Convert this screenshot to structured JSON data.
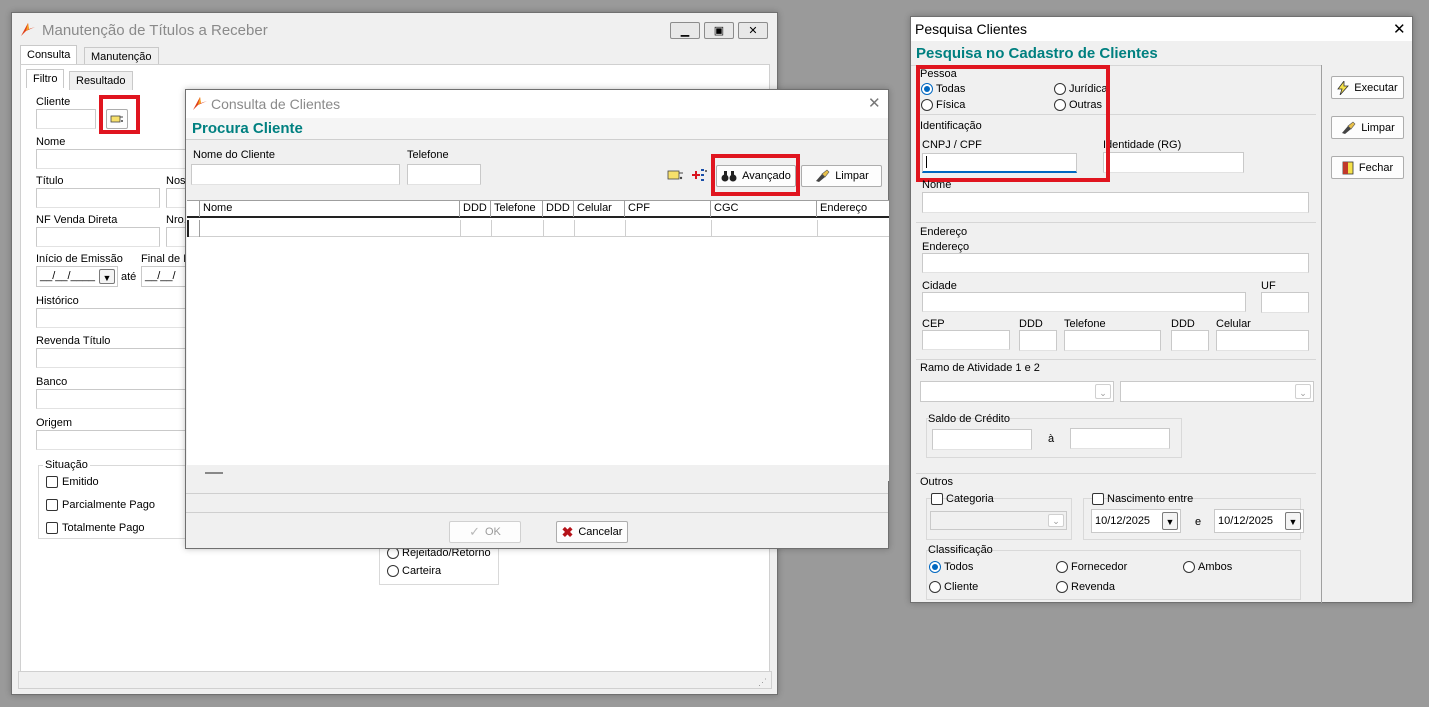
{
  "win1": {
    "title": "Manutenção de Títulos a Receber",
    "tabs": [
      "Consulta",
      "Manutenção"
    ],
    "subtabs": [
      "Filtro",
      "Resultado"
    ],
    "labels": {
      "cliente": "Cliente",
      "nome": "Nome",
      "titulo": "Título",
      "nosso": "Noss",
      "nf_venda": "NF Venda Direta",
      "nro": "Nro.",
      "inicio_emissao": "Início de Emissão",
      "final": "Final de E",
      "ate": "até",
      "historico": "Histórico",
      "revenda": "Revenda Título",
      "banco": "Banco",
      "origem": "Origem"
    },
    "date_value": "__/__/____",
    "date_value2": "__/__/",
    "situacao": {
      "label": "Situação",
      "items": [
        "Emitido",
        "Parcialmente Pago",
        "Totalmente Pago"
      ]
    },
    "extra_radios": [
      "Rejeitado/Retorno",
      "Carteira"
    ]
  },
  "win2": {
    "title": "Consulta de Clientes",
    "heading": "Procura Cliente",
    "labels": {
      "nome_cliente": "Nome do Cliente",
      "telefone": "Telefone"
    },
    "buttons": {
      "avancado": "Avançado",
      "limpar": "Limpar",
      "ok": "OK",
      "cancelar": "Cancelar"
    },
    "grid_columns": [
      "Nome",
      "DDD",
      "Telefone",
      "DDD",
      "Celular",
      "CPF",
      "CGC",
      "Endereço"
    ]
  },
  "win3": {
    "title": "Pesquisa Clientes",
    "heading": "Pesquisa no Cadastro de Clientes",
    "pessoa": {
      "label": "Pessoa",
      "todas": "Todas",
      "juridica": "Jurídica",
      "fisica": "Física",
      "outras": "Outras"
    },
    "identificacao": {
      "label": "Identificação",
      "cnpj": "CNPJ / CPF",
      "rg": "Identidade (RG)",
      "nome": "Nome"
    },
    "endereco": {
      "label": "Endereço",
      "endereco": "Endereço",
      "cidade": "Cidade",
      "uf": "UF",
      "cep": "CEP",
      "ddd": "DDD",
      "telefone": "Telefone",
      "ddd2": "DDD",
      "celular": "Celular"
    },
    "ramo": {
      "label": "Ramo de Atividade 1 e 2"
    },
    "saldo": {
      "label": "Saldo de Crédito",
      "a": "à"
    },
    "outros": {
      "label": "Outros",
      "categoria": "Categoria",
      "nascimento": "Nascimento entre",
      "data_inicio": "10/12/2025",
      "e": "e",
      "data_fim": "10/12/2025"
    },
    "classificacao": {
      "label": "Classificação",
      "todos": "Todos",
      "fornecedor": "Fornecedor",
      "ambos": "Ambos",
      "cliente": "Cliente",
      "revenda": "Revenda"
    },
    "buttons": {
      "executar": "Executar",
      "limpar": "Limpar",
      "fechar": "Fechar"
    }
  },
  "colors": {
    "accent_teal": "#008080",
    "highlight_red": "#e0151f",
    "radio_blue": "#0067c0"
  }
}
